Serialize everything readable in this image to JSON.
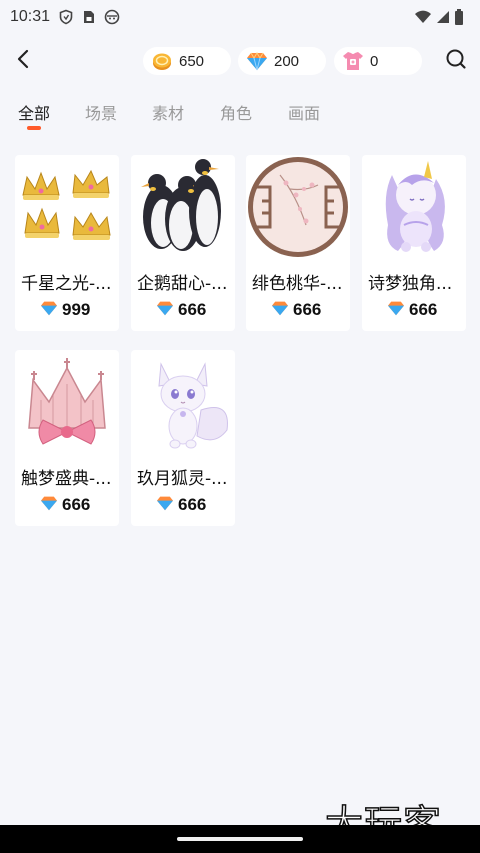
{
  "status_bar": {
    "time": "10:31",
    "icons": [
      "shield-icon",
      "sim-card-icon",
      "android-face-icon",
      "wifi-icon",
      "signal-icon",
      "battery-icon"
    ]
  },
  "header": {
    "back_icon": "chevron-left-icon",
    "currencies": [
      {
        "name": "gold-coin",
        "value": "650"
      },
      {
        "name": "gem",
        "value": "200"
      },
      {
        "name": "shirt-coupon",
        "value": "0"
      }
    ],
    "search_icon": "search-icon"
  },
  "tabs": [
    {
      "label": "全部",
      "active": true
    },
    {
      "label": "场景",
      "active": false
    },
    {
      "label": "素材",
      "active": false
    },
    {
      "label": "角色",
      "active": false
    },
    {
      "label": "画面",
      "active": false
    }
  ],
  "items": [
    {
      "title": "千星之光-...",
      "price": "999",
      "image": "gold-crowns"
    },
    {
      "title": "企鹅甜心-...",
      "price": "666",
      "image": "penguins"
    },
    {
      "title": "绯色桃华-...",
      "price": "666",
      "image": "peach-blossom-window"
    },
    {
      "title": "诗梦独角...",
      "price": "666",
      "image": "unicorn-girl"
    },
    {
      "title": "触梦盛典-...",
      "price": "666",
      "image": "pink-bow-crown"
    },
    {
      "title": "玖月狐灵-...",
      "price": "666",
      "image": "white-fox"
    }
  ],
  "watermark": "大玩客",
  "colors": {
    "background": "#f5f6fa",
    "tab_indicator": "#ff5a2a",
    "card": "#ffffff"
  }
}
